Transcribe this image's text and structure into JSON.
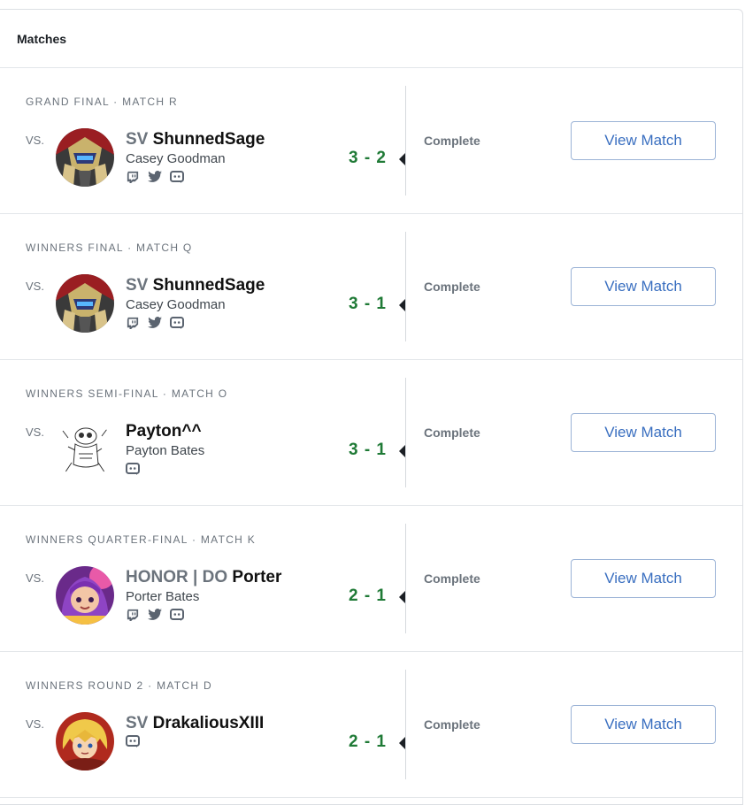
{
  "panel": {
    "title": "Matches"
  },
  "matches": [
    {
      "round": "Grand Final · Match R",
      "vs": "VS.",
      "prefix": "SV",
      "gamertag": "ShunnedSage",
      "real_name": "Casey Goodman",
      "score": "3 - 2",
      "status": "Complete",
      "button": "View Match",
      "avatar": "robot-knight-avatar",
      "socials": [
        "twitch-icon",
        "twitter-icon",
        "discord-icon"
      ]
    },
    {
      "round": "Winners Final · Match Q",
      "vs": "VS.",
      "prefix": "SV",
      "gamertag": "ShunnedSage",
      "real_name": "Casey Goodman",
      "score": "3 - 1",
      "status": "Complete",
      "button": "View Match",
      "avatar": "robot-knight-avatar",
      "socials": [
        "twitch-icon",
        "twitter-icon",
        "discord-icon"
      ]
    },
    {
      "round": "Winners Semi-Final · Match O",
      "vs": "VS.",
      "prefix": "",
      "gamertag": "Payton^^",
      "real_name": "Payton Bates",
      "score": "3 - 1",
      "status": "Complete",
      "button": "View Match",
      "avatar": "sketch-character-avatar",
      "socials": [
        "discord-icon"
      ]
    },
    {
      "round": "Winners Quarter-Final · Match K",
      "vs": "VS.",
      "prefix": "HONOR | DO",
      "gamertag": "Porter",
      "real_name": "Porter Bates",
      "score": "2 - 1",
      "status": "Complete",
      "button": "View Match",
      "avatar": "purple-haired-character-avatar",
      "socials": [
        "twitch-icon",
        "twitter-icon",
        "discord-icon"
      ]
    },
    {
      "round": "Winners Round 2 · Match D",
      "vs": "VS.",
      "prefix": "SV",
      "gamertag": "DrakaliousXIII",
      "real_name": "",
      "score": "2 - 1",
      "status": "Complete",
      "button": "View Match",
      "avatar": "blonde-character-avatar",
      "socials": [
        "discord-icon"
      ]
    }
  ],
  "colors": {
    "score_green": "#1f7a36",
    "button_blue": "#3a6fc0",
    "muted_text": "#6b737c"
  }
}
